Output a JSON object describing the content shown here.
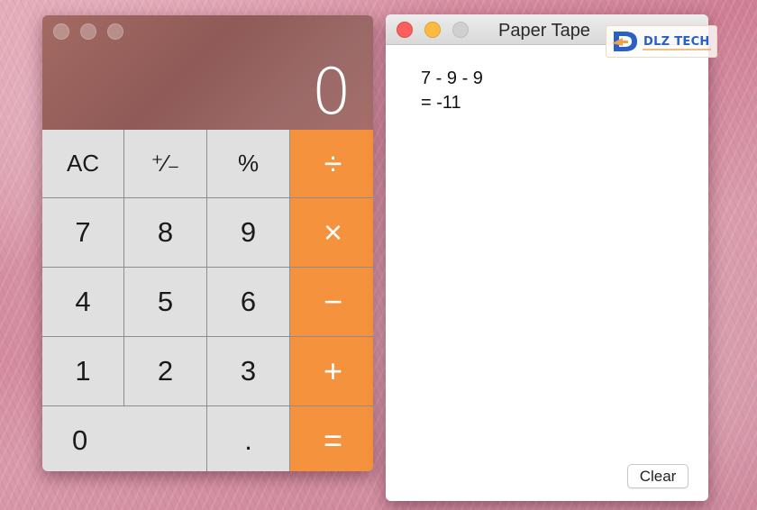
{
  "calculator": {
    "display": "0",
    "keys": {
      "ac": "AC",
      "sign": "⁺∕₋",
      "percent": "%",
      "divide": "÷",
      "seven": "7",
      "eight": "8",
      "nine": "9",
      "multiply": "×",
      "four": "4",
      "five": "5",
      "six": "6",
      "minus": "−",
      "one": "1",
      "two": "2",
      "three": "3",
      "plus": "+",
      "zero": "0",
      "decimal": ".",
      "equals": "="
    },
    "colors": {
      "operator": "#f5923e",
      "key": "#e0e0e0"
    }
  },
  "paper_tape": {
    "title": "Paper Tape",
    "lines": [
      "7 - 9 - 9",
      "= -11"
    ],
    "clear_label": "Clear"
  },
  "watermark": {
    "text": "DLZ TECH",
    "icon": "dlz-logo-icon"
  }
}
